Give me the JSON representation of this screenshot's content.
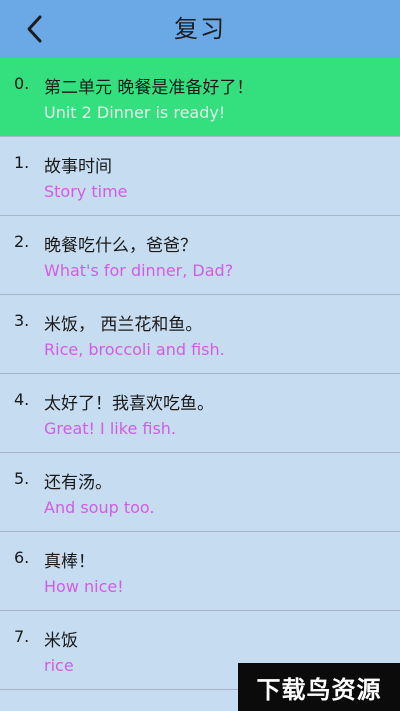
{
  "header": {
    "title": "复习",
    "back_icon": "chevron-left-icon",
    "background": "#6aa8e6"
  },
  "items": [
    {
      "num": "0.",
      "zh": "第二单元 晚餐是准备好了！",
      "en": "Unit 2 Dinner is ready!",
      "selected": true
    },
    {
      "num": "1.",
      "zh": "故事时间",
      "en": "Story time"
    },
    {
      "num": "2.",
      "zh": "晚餐吃什么，爸爸？",
      "en": "What's for dinner, Dad?"
    },
    {
      "num": "3.",
      "zh": "米饭， 西兰花和鱼。",
      "en": "Rice, broccoli and fish."
    },
    {
      "num": "4.",
      "zh": "太好了！我喜欢吃鱼。",
      "en": "Great! I like fish."
    },
    {
      "num": "5.",
      "zh": "还有汤。",
      "en": "And soup too."
    },
    {
      "num": "6.",
      "zh": "真棒！",
      "en": "How nice!"
    },
    {
      "num": "7.",
      "zh": "米饭",
      "en": "rice"
    }
  ],
  "colors": {
    "list_background": "#c6dcf0",
    "selected_row": "#34e07e",
    "english_text": "#d25ce6"
  },
  "watermark": {
    "text": "下载鸟资源"
  }
}
